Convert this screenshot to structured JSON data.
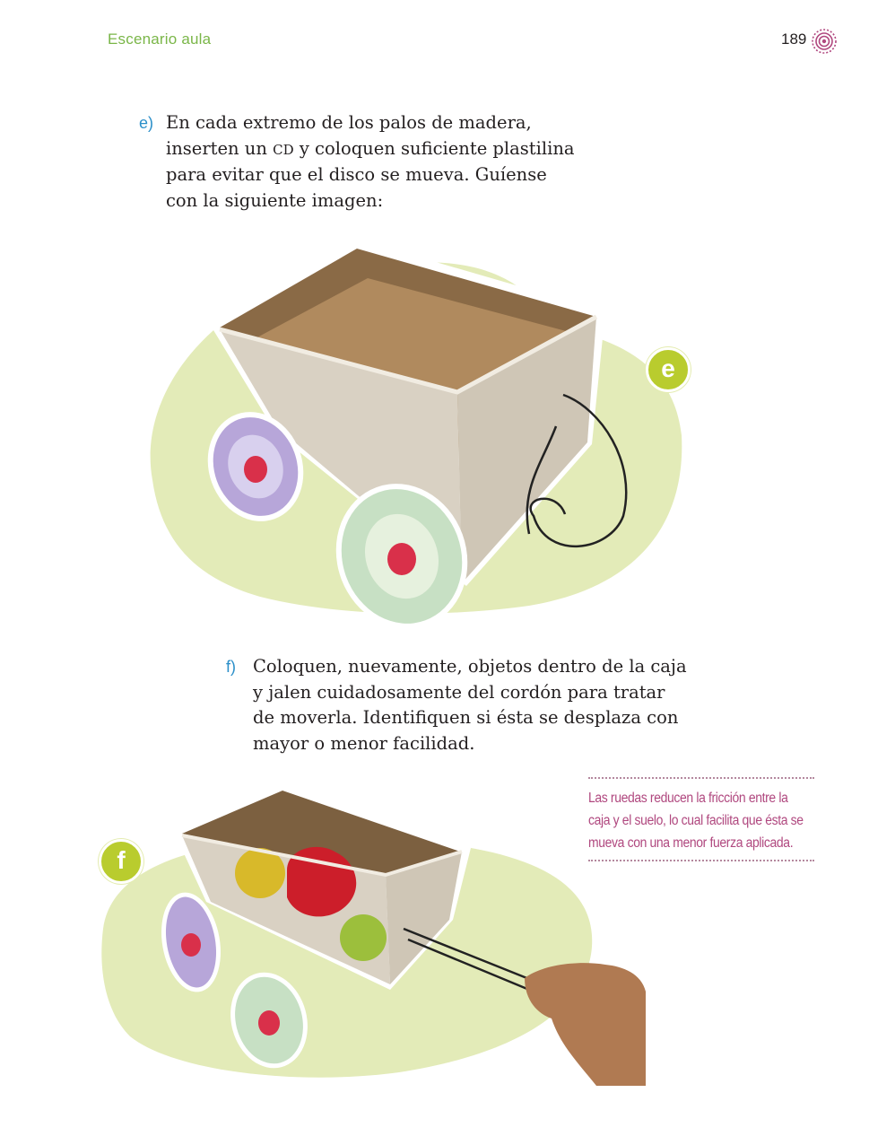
{
  "header": {
    "section_title": "Escenario aula",
    "page_number": "189"
  },
  "steps": [
    {
      "marker": "e)",
      "lines": [
        [
          "En cada extremo de los palos de madera,"
        ],
        [
          "inserten un ",
          "CD",
          " y coloquen suficiente plastilina"
        ],
        [
          "para evitar que el disco se mueva. Guíense"
        ],
        [
          "con la siguiente imagen:"
        ]
      ]
    },
    {
      "marker": "f)",
      "lines": [
        "Coloquen, nuevamente, objetos dentro de la caja",
        "y jalen cuidadosamente del cordón para tratar",
        "de moverla. Identifiquen si ésta se desplaza con",
        "mayor o menor facilidad."
      ]
    }
  ],
  "figures": [
    {
      "badge": "e"
    },
    {
      "badge": "f"
    }
  ],
  "side_note": {
    "lines": [
      "Las ruedas reducen la fricción entre la",
      "caja y el suelo, lo cual facilita que ésta se",
      "mueva con una menor fuerza aplicada."
    ]
  },
  "colors": {
    "section_green": "#7ab648",
    "marker_blue": "#2b8fc9",
    "note_magenta": "#b0487f",
    "blob_green": "#e3ebb8",
    "badge_green": "#b9cc2e"
  }
}
